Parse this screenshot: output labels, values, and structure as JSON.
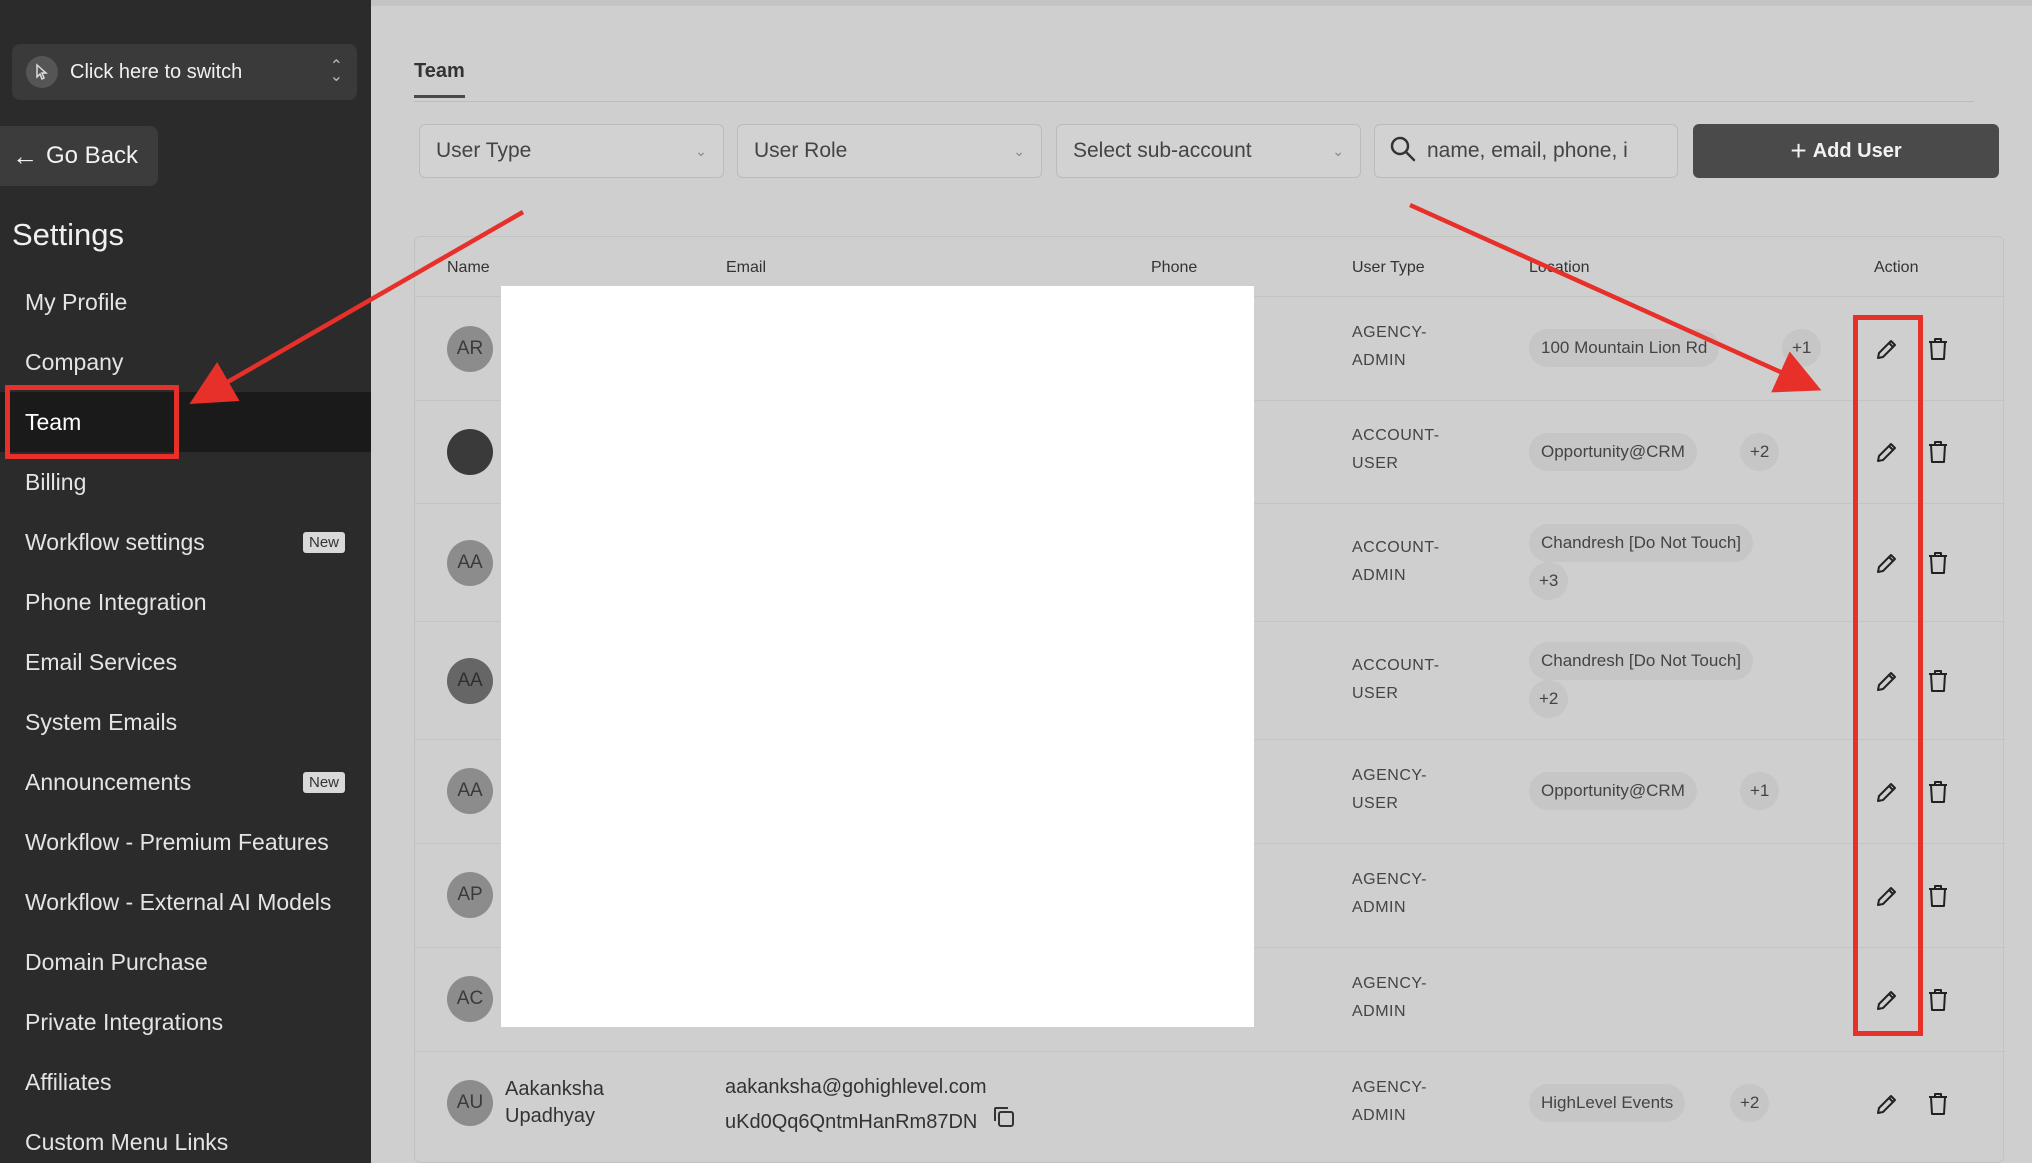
{
  "sidebar": {
    "switcher_label": "Click here to switch",
    "go_back": "Go Back",
    "settings_title": "Settings",
    "items": [
      {
        "label": "My Profile",
        "badge": null
      },
      {
        "label": "Company",
        "badge": null
      },
      {
        "label": "Team",
        "badge": null,
        "active": true
      },
      {
        "label": "Billing",
        "badge": null
      },
      {
        "label": "Workflow settings",
        "badge": "New"
      },
      {
        "label": "Phone Integration",
        "badge": null
      },
      {
        "label": "Email Services",
        "badge": null
      },
      {
        "label": "System Emails",
        "badge": null
      },
      {
        "label": "Announcements",
        "badge": "New"
      },
      {
        "label": "Workflow - Premium Features",
        "badge": null
      },
      {
        "label": "Workflow - External AI Models",
        "badge": null
      },
      {
        "label": "Domain Purchase",
        "badge": null
      },
      {
        "label": "Private Integrations",
        "badge": null
      },
      {
        "label": "Affiliates",
        "badge": null
      },
      {
        "label": "Custom Menu Links",
        "badge": null
      }
    ]
  },
  "main": {
    "tab": "Team",
    "filters": {
      "user_type": "User Type",
      "user_role": "User Role",
      "sub_account": "Select sub-account",
      "search_placeholder": "name, email, phone, i"
    },
    "add_user": "Add User",
    "columns": {
      "name": "Name",
      "email": "Email",
      "phone": "Phone",
      "user_type": "User Type",
      "location": "Location",
      "action": "Action"
    },
    "rows": [
      {
        "initials": "AR",
        "user_type_1": "AGENCY-",
        "user_type_2": "ADMIN",
        "location": "100 Mountain Lion Rd",
        "more": "+1"
      },
      {
        "initials": "",
        "user_type_1": "ACCOUNT-",
        "user_type_2": "USER",
        "location": "Opportunity@CRM",
        "more": "+2"
      },
      {
        "initials": "AA",
        "user_type_1": "ACCOUNT-",
        "user_type_2": "ADMIN",
        "location": "Chandresh [Do Not Touch]",
        "more": "+3"
      },
      {
        "initials": "AA",
        "user_type_1": "ACCOUNT-",
        "user_type_2": "USER",
        "location": "Chandresh [Do Not Touch]",
        "more": "+2"
      },
      {
        "initials": "AA",
        "user_type_1": "AGENCY-",
        "user_type_2": "USER",
        "location": "Opportunity@CRM",
        "more": "+1"
      },
      {
        "initials": "AP",
        "user_type_1": "AGENCY-",
        "user_type_2": "ADMIN",
        "location": "",
        "more": ""
      },
      {
        "initials": "AC",
        "user_type_1": "AGENCY-",
        "user_type_2": "ADMIN",
        "location": "",
        "more": ""
      },
      {
        "initials": "AU",
        "name_1": "Aakanksha",
        "name_2": "Upadhyay",
        "email": "aakanksha@gohighlevel.com",
        "id": "uKd0Qq6QntmHanRm87DN",
        "user_type_1": "AGENCY-",
        "user_type_2": "ADMIN",
        "location": "HighLevel Events",
        "more": "+2"
      }
    ]
  },
  "colors": {
    "annotation": "#e8302a",
    "sidebar_bg": "#2b2b2b",
    "main_bg": "#cfcfcf"
  }
}
